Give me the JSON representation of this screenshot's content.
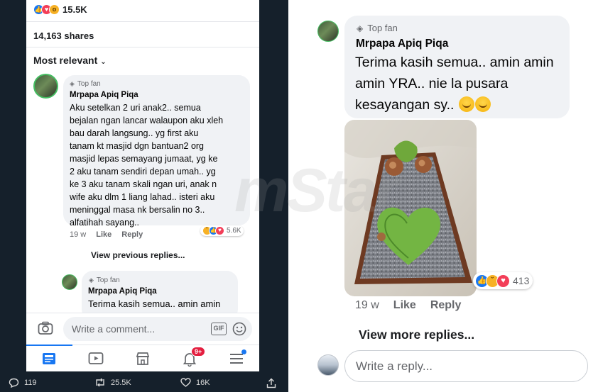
{
  "left_post": {
    "reaction_count": "15.5K",
    "shares": "14,163 shares",
    "sort_label": "Most relevant",
    "comment1": {
      "badge": "Top fan",
      "author": "Mrpapa Apiq Piqa",
      "lines": [
        "Aku setelkan 2 uri anak2.. semua",
        "bejalan ngan lancar walaupon aku xleh",
        "bau darah langsung.. yg first aku",
        "tanam kt masjid dgn bantuan2 org",
        "masjid lepas semayang jumaat, yg ke",
        "2 aku tanam sendiri depan umah.. yg",
        "ke 3 aku tanam skali ngan uri, anak n",
        "wife aku dlm 1 liang lahad.. isteri aku",
        "meninggal masa nk bersalin no 3..",
        "alfatihah sayang.."
      ],
      "time": "19 w",
      "like": "Like",
      "reply": "Reply",
      "reaction_count": "5.6K"
    },
    "view_previous": "View previous replies...",
    "reply1": {
      "badge": "Top fan",
      "author": "Mrpapa Apiq Piqa",
      "text": "Terima kasih semua.. amin amin"
    },
    "comment_placeholder": "Write a comment...",
    "gif_label": "GIF",
    "notification_badge": "9+",
    "accent": "#1877f2"
  },
  "tweet_actions": {
    "replies": "119",
    "retweets": "25.5K",
    "likes": "16K"
  },
  "right_comment": {
    "badge": "Top fan",
    "author": "Mrpapa Apiq Piqa",
    "lines": [
      "Terima kasih semua.. amin amin",
      "amin YRA.. nie la pusara",
      "kesayangan sy.."
    ],
    "reaction_count": "413",
    "time": "19 w",
    "like": "Like",
    "reply": "Reply",
    "view_more": "View more replies...",
    "reply_placeholder": "Write a reply..."
  },
  "watermark": "mStar"
}
